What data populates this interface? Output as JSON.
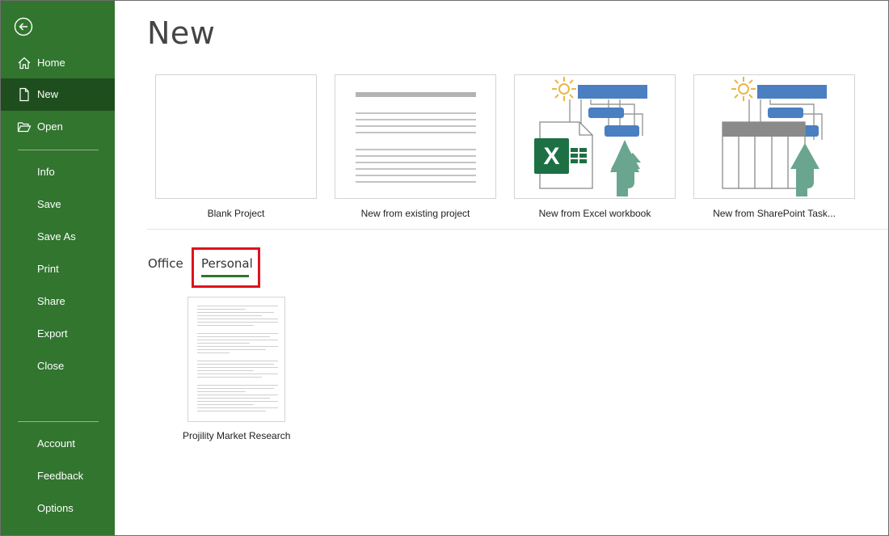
{
  "sidebar": {
    "items": [
      {
        "label": "Home",
        "icon": "home-icon"
      },
      {
        "label": "New",
        "icon": "new-document-icon",
        "selected": true
      },
      {
        "label": "Open",
        "icon": "open-folder-icon"
      },
      {
        "label": "Info"
      },
      {
        "label": "Save"
      },
      {
        "label": "Save As"
      },
      {
        "label": "Print"
      },
      {
        "label": "Share"
      },
      {
        "label": "Export"
      },
      {
        "label": "Close"
      },
      {
        "label": "Account"
      },
      {
        "label": "Feedback"
      },
      {
        "label": "Options"
      }
    ],
    "back_icon": "back-arrow-icon",
    "background": "#31752f",
    "selected_background": "#1e4e1e"
  },
  "main": {
    "title": "New",
    "templates": [
      {
        "label": "Blank Project"
      },
      {
        "label": "New from existing project"
      },
      {
        "label": "New from Excel workbook"
      },
      {
        "label": "New from SharePoint Task..."
      }
    ],
    "tabs": [
      {
        "label": "Office"
      },
      {
        "label": "Personal",
        "selected": true
      }
    ],
    "personal_templates": [
      {
        "label": "Projility Market Research"
      }
    ]
  },
  "colors": {
    "accent": "#31752f",
    "highlight": "#e0121a",
    "gantt_blue": "#4a7fc1",
    "arrow_green": "#6aa58f",
    "excel_green": "#1d7044",
    "sun": "#e8b84a"
  }
}
